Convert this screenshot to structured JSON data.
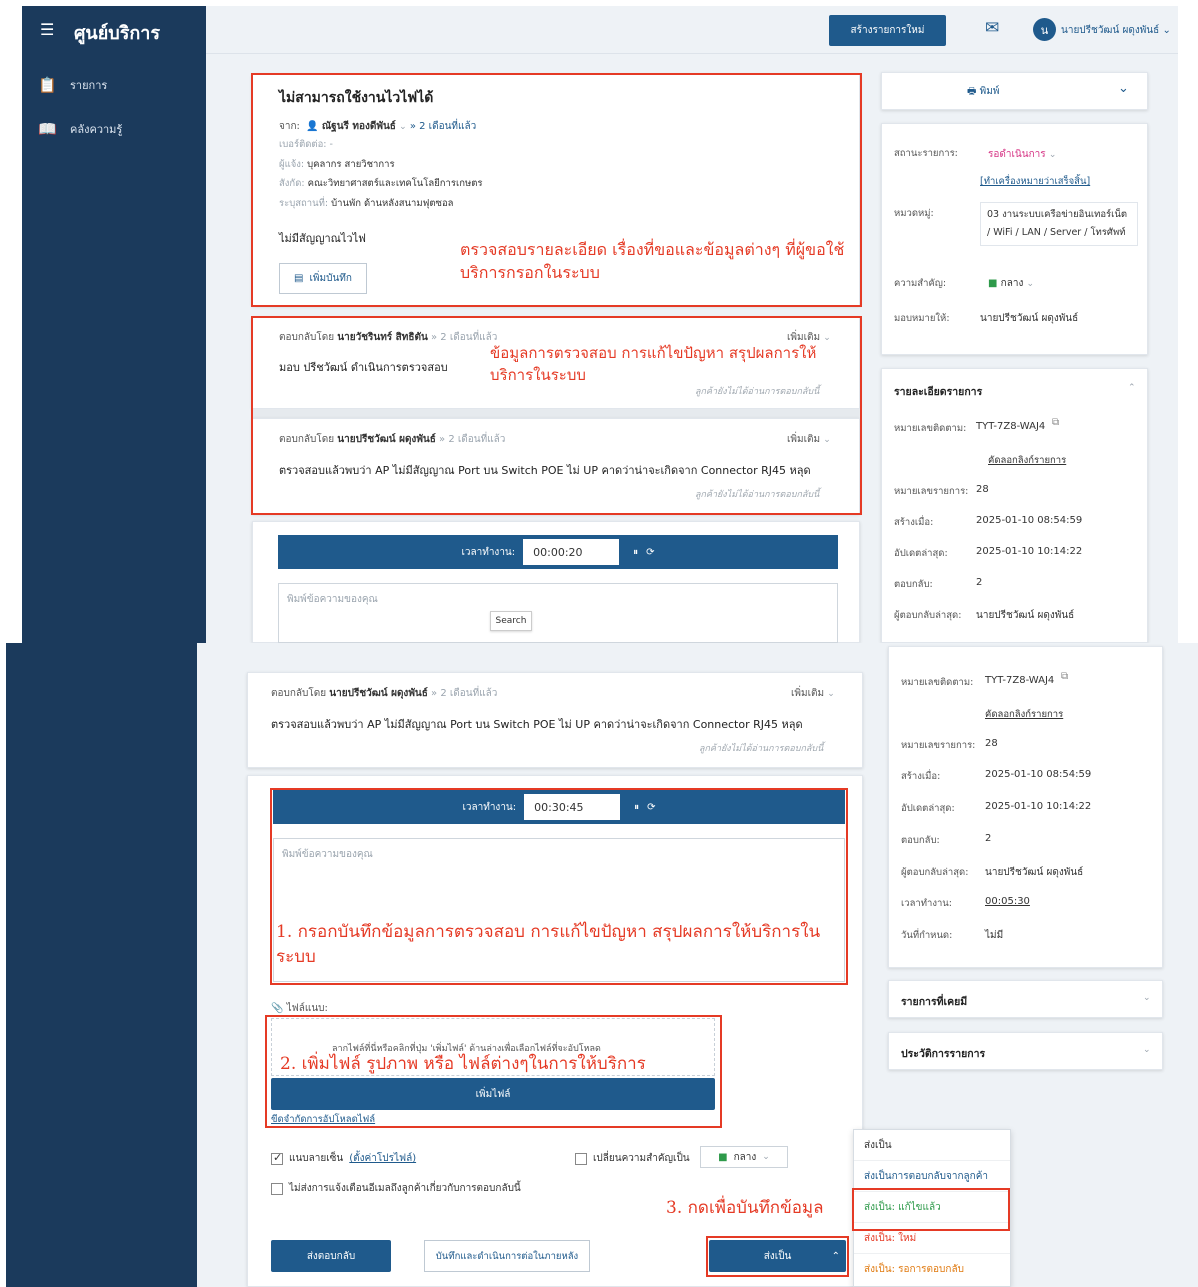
{
  "app": {
    "title": "ศูนย์บริการ",
    "menu": [
      "รายการ",
      "คลังความรู้"
    ]
  },
  "topbar": {
    "new_button": "สร้างรายการใหม่",
    "user_initial": "น",
    "user_name": "นายปรีชวัฒน์ ผดุงพันธ์"
  },
  "ticket": {
    "title": "ไม่สามารถใช้งานไวไฟได้",
    "from_label": "จาก:",
    "requester": "ณัฐนรี ทองดีพันธ์",
    "age": "» 2 เดือนที่แล้ว",
    "phone": "เบอร์ติดต่อ: -",
    "reporter_label": "ผู้แจ้ง:",
    "reporter": "บุคลากร สายวิชาการ",
    "dept_label": "สังกัด:",
    "dept": "คณะวิทยาศาสตร์และเทคโนโลยีการเกษตร",
    "place_label": "ระบุสถานที่:",
    "place": "บ้านพัก ด้านหลังสนามฟุตซอล",
    "description": "ไม่มีสัญญาณไวไฟ",
    "add_note": "เพิ่มบันทึก"
  },
  "responses": [
    {
      "by_label": "ตอบกลับโดย",
      "by": "นายวัชรินทร์ สิทธิตัน",
      "age": "» 2 เดือนที่แล้ว",
      "more": "เพิ่มเติม",
      "body": "มอบ ปรีชวัฒน์ ดำเนินการตรวจสอบ",
      "foot": "ลูกค้ายังไม่ได้อ่านการตอบกลับนี้"
    },
    {
      "by_label": "ตอบกลับโดย",
      "by": "นายปรีชวัฒน์ ผดุงพันธ์",
      "age": "» 2 เดือนที่แล้ว",
      "more": "เพิ่มเติม",
      "body": "ตรวจสอบแล้วพบว่า AP ไม่มีสัญญาณ Port บน Switch POE ไม่ UP คาดว่าน่าจะเกิดจาก Connector RJ45 หลุด",
      "foot": "ลูกค้ายังไม่ได้อ่านการตอบกลับนี้"
    }
  ],
  "timer": {
    "label": "เวลาทำงาน:",
    "value_top": "00:00:20",
    "value_bottom": "00:30:45"
  },
  "composer": {
    "placeholder": "พิมพ์ข้อความของคุณ",
    "search_tip": "Search",
    "attach_label": "ไฟล์แนบ:",
    "drop_text": "ลากไฟล์ที่นี่หรือคลิกที่ปุ่ม 'เพิ่มไฟล์' ด้านล่างเพื่อเลือกไฟล์ที่จะอัปโหลด",
    "add_file": "เพิ่มไฟล์",
    "upload_limit": "ขีดจำกัดการอัปโหลดไฟล์",
    "signature": "แนบลายเซ็น",
    "signature_link": "(ตั้งค่าโปรไฟล์)",
    "change_priority": "เปลี่ยนความสำคัญเป็น",
    "priority": "กลาง",
    "no_email": "ไม่ส่งการแจ้งเตือนอีเมลถึงลูกค้าเกี่ยวกับการตอบกลับนี้",
    "send_reply": "ส่งตอบกลับ",
    "save_later": "บันทึกและดำเนินการต่อในภายหลัง",
    "send_as": "ส่งเป็น"
  },
  "send_menu": [
    "ส่งเป็น",
    "ส่งเป็นการตอบกลับจากลูกค้า",
    "ส่งเป็น: แก้ไขแล้ว",
    "ส่งเป็น: ใหม่",
    "ส่งเป็น: รอการตอบกลับ"
  ],
  "right": {
    "print": "พิมพ์",
    "status_label": "สถานะรายการ:",
    "status": "รอดำเนินการ",
    "mark_done": "[ทำเครื่องหมายว่าเสร็จสิ้น]",
    "category_label": "หมวดหมู่:",
    "category": "03 งานระบบเครือข่ายอินเทอร์เน็ต / WiFi / LAN / Server / โทรศัพท์",
    "priority_label": "ความสำคัญ:",
    "priority": "กลาง",
    "assign_label": "มอบหมายให้:",
    "assignee": "นายปรีชวัฒน์ ผดุงพันธ์",
    "details_h": "รายละเอียดรายการ",
    "track_label": "หมายเลขติดตาม:",
    "track": "TYT-7Z8-WAJ4",
    "copy_link": "คัดลอกลิงก์รายการ",
    "num_label": "หมายเลขรายการ:",
    "num": "28",
    "created_label": "สร้างเมื่อ:",
    "created": "2025-01-10 08:54:59",
    "updated_label": "อัปเดตล่าสุด:",
    "updated": "2025-01-10 10:14:22",
    "replies_label": "ตอบกลับ:",
    "replies": "2",
    "last_replier_label": "ผู้ตอบกลับล่าสุด:",
    "last_replier": "นายปรีชวัฒน์ ผดุงพันธ์",
    "worktime_label": "เวลาทำงาน:",
    "worktime": "00:05:30",
    "due_label": "วันที่กำหนด:",
    "due": "ไม่มี",
    "prev_h": "รายการที่เคยมี",
    "history_h": "ประวัติการรายการ"
  },
  "notes": {
    "n1": "ตรวจสอบรายละเอียด เรื่องที่ขอและข้อมูลต่างๆ ที่ผู้ขอใช้บริการกรอกในระบบ",
    "n2": "ข้อมูลการตรวจสอบ การแก้ไขปัญหา สรุปผลการให้บริการในระบบ",
    "n3": "1. กรอกบันทึกข้อมูลการตรวจสอบ การแก้ไขปัญหา สรุปผลการให้บริการในระบบ",
    "n4": "2. เพิ่มไฟล์ รูปภาพ หรือ ไฟล์ต่างๆในการให้บริการ",
    "n5": "3. กดเพื่อบันทึกข้อมูล"
  },
  "colors": {
    "navy": "#1b3a5c",
    "accent": "#1f5a8c",
    "annot": "#e53a25",
    "status": "#d63384",
    "green": "#2e9a4a"
  }
}
